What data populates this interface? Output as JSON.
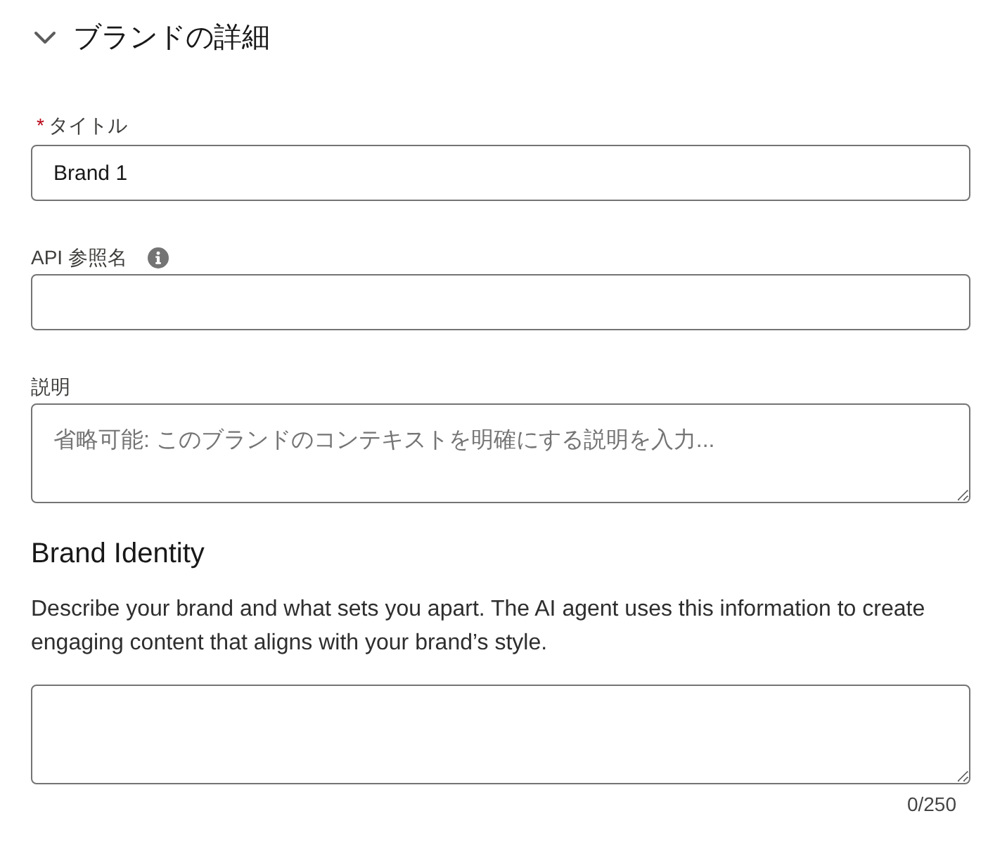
{
  "section": {
    "title": "ブランドの詳細",
    "expanded": true
  },
  "fields": [
    {
      "kind": "input",
      "required_mark": "*",
      "label": "タイトル",
      "value": "Brand 1"
    },
    {
      "kind": "input",
      "label": "API 参照名",
      "info": true
    },
    {
      "kind": "textarea",
      "label": "説明",
      "placeholder": "省略可能: このブランドのコンテキストを明確にする説明を入力..."
    }
  ],
  "brand_identity": {
    "title": "Brand Identity",
    "description": "Describe your brand and what sets you apart. The AI agent uses this information to create engaging content that aligns with your brand’s style.",
    "field": {
      "kind": "textarea",
      "counter": "0/250"
    }
  }
}
